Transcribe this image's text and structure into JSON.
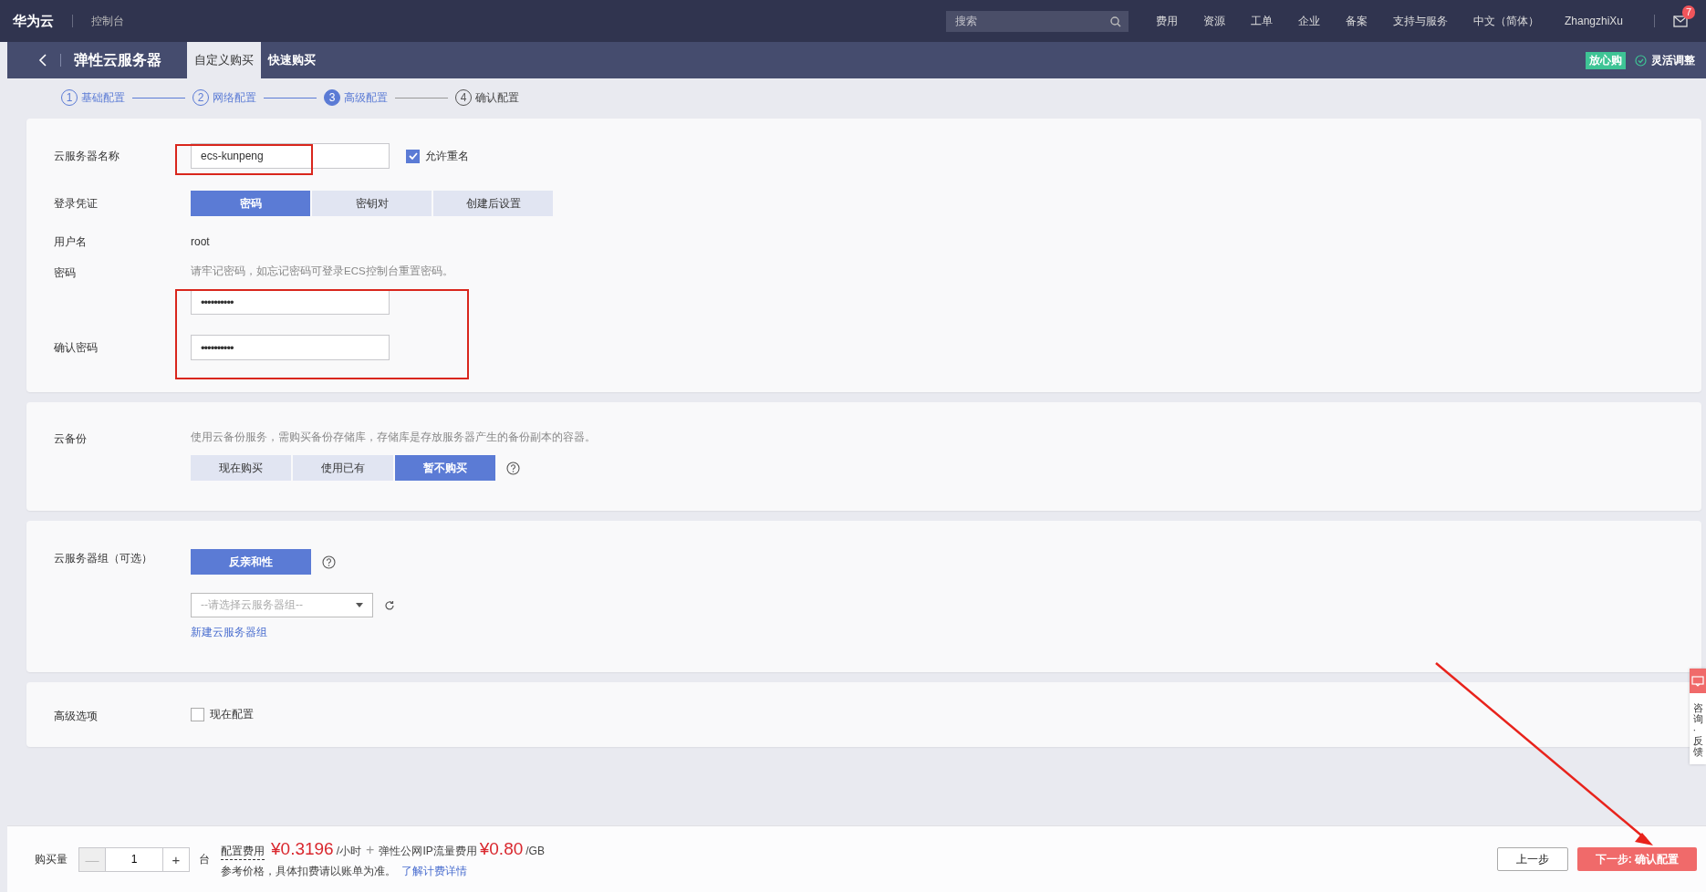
{
  "topbar": {
    "logo": "华为云",
    "console": "控制台",
    "search": {
      "placeholder": "搜索"
    },
    "menu": [
      "费用",
      "资源",
      "工单",
      "企业",
      "备案",
      "支持与服务",
      "中文（简体）",
      "ZhangzhiXu"
    ],
    "mail_badge": "7"
  },
  "subbar": {
    "title": "弹性云服务器",
    "tabs": [
      {
        "label": "自定义购买",
        "selected": true
      },
      {
        "label": "快速购买",
        "selected": false
      }
    ],
    "tag": "放心购",
    "flex_label": "灵活调整"
  },
  "steps": [
    {
      "number": "1",
      "label": "基础配置",
      "done": true,
      "current": false
    },
    {
      "number": "2",
      "label": "网络配置",
      "done": true,
      "current": false
    },
    {
      "number": "3",
      "label": "高级配置",
      "done": false,
      "current": true
    },
    {
      "number": "4",
      "label": "确认配置",
      "done": false,
      "current": false
    }
  ],
  "basic": {
    "name_label": "云服务器名称",
    "name_value": "ecs-kunpeng",
    "allow_duplicate": {
      "label": "允许重名",
      "checked": true
    },
    "credential": {
      "label": "登录凭证",
      "options": [
        {
          "label": "密码",
          "selected": true
        },
        {
          "label": "密钥对",
          "selected": false
        },
        {
          "label": "创建后设置",
          "selected": false
        }
      ]
    },
    "username": {
      "label": "用户名",
      "value": "root"
    },
    "password": {
      "label": "密码",
      "hint": "请牢记密码，如忘记密码可登录ECS控制台重置密码。",
      "value": "••••••••••"
    },
    "confirm": {
      "label": "确认密码",
      "value": "••••••••••"
    }
  },
  "backup": {
    "label": "云备份",
    "hint": "使用云备份服务，需购买备份存储库，存储库是存放服务器产生的备份副本的容器。",
    "options": [
      {
        "label": "现在购买",
        "selected": false
      },
      {
        "label": "使用已有",
        "selected": false
      },
      {
        "label": "暂不购买",
        "selected": true
      }
    ]
  },
  "group": {
    "label": "云服务器组（可选）",
    "policy": {
      "label": "反亲和性",
      "selected": true
    },
    "select": {
      "placeholder": "--请选择云服务器组--"
    },
    "link": "新建云服务器组"
  },
  "advanced": {
    "label": "高级选项",
    "option": {
      "label": "现在配置",
      "checked": false
    }
  },
  "footer": {
    "qty_label": "购买量",
    "minus": "—",
    "minus_disabled": true,
    "qty": "1",
    "plus": "+",
    "unit": "台",
    "fee_label": "配置费用",
    "fee": "¥0.3196",
    "fee_unit": "/小时",
    "plus_sign": "+",
    "ip_label": "弹性公网IP流量费用",
    "ip_fee": "¥0.80",
    "ip_unit": "/GB",
    "note": "参考价格，具体扣费请以账单为准。",
    "note_link": "了解计费详情",
    "prev": "上一步",
    "next": "下一步: 确认配置"
  },
  "side_widget": {
    "text": "咨询·反馈"
  }
}
